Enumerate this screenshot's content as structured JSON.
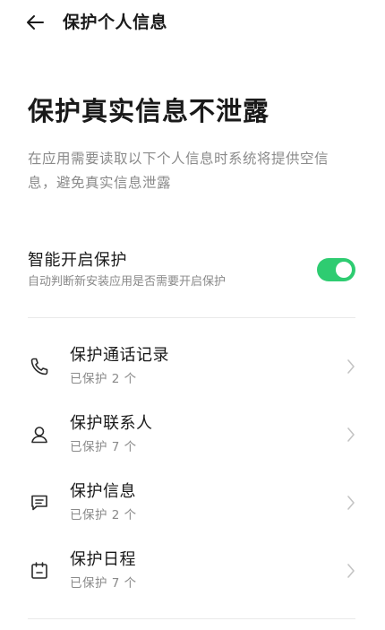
{
  "header": {
    "title": "保护个人信息",
    "back_icon": "back-arrow-icon"
  },
  "main": {
    "title": "保护真实信息不泄露",
    "description": "在应用需要读取以下个人信息时系统将提供空信息，避免真实信息泄露"
  },
  "smart_protection": {
    "title": "智能开启保护",
    "subtitle": "自动判断新安装应用是否需要开启保护",
    "enabled": true,
    "accent_color": "#2ecc71"
  },
  "items": [
    {
      "title": "保护通话记录",
      "subtitle": "已保护 2 个",
      "icon": "phone-icon"
    },
    {
      "title": "保护联系人",
      "subtitle": "已保护 7 个",
      "icon": "person-icon"
    },
    {
      "title": "保护信息",
      "subtitle": "已保护 2 个",
      "icon": "message-icon"
    },
    {
      "title": "保护日程",
      "subtitle": "已保护 7 个",
      "icon": "calendar-icon"
    }
  ]
}
